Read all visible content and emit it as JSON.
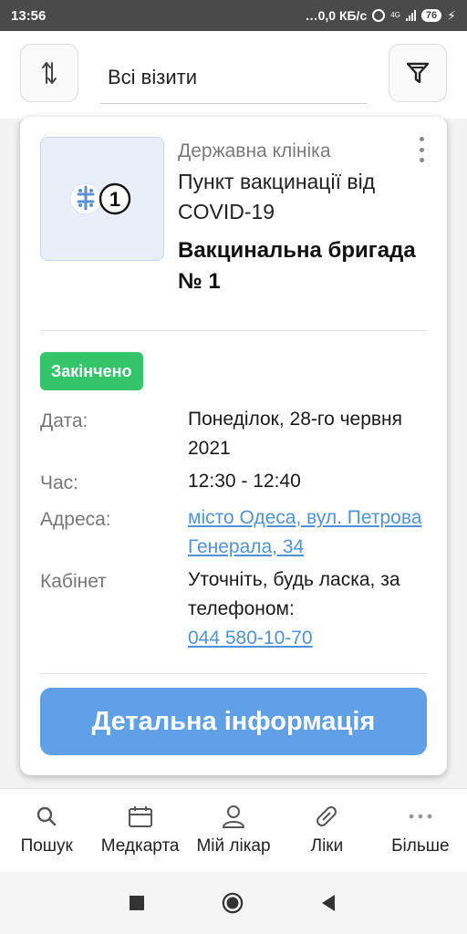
{
  "status_bar": {
    "time": "13:56",
    "speed": "…0,0 КБ/с",
    "network": "4G",
    "battery": "76"
  },
  "header": {
    "filter_select": "Всі візити"
  },
  "visit_card": {
    "clinic_type": "Державна клініка",
    "clinic_name": "Пункт вакцинації від COVID-19",
    "doctor_name": "Вакцинальна бригада № 1",
    "status": "Закінчено",
    "date_label": "Дата:",
    "date_value": "Понеділок, 28-го червня 2021",
    "time_label": "Час:",
    "time_value": "12:30 - 12:40",
    "address_label": "Адреса:",
    "address_value": "місто Одеса, вул. Петрова Генерала, 34",
    "room_label": "Кабінет",
    "room_value": "Уточніть, будь ласка, за телефоном:",
    "phone": "044 580-10-70",
    "details_button": "Детальна інформація",
    "thumb_number": "1"
  },
  "bottom_nav": {
    "items": [
      {
        "label": "Пошук",
        "icon": "search-icon"
      },
      {
        "label": "Медкарта",
        "icon": "calendar-icon"
      },
      {
        "label": "Мій лікар",
        "icon": "doctor-icon"
      },
      {
        "label": "Ліки",
        "icon": "pill-icon"
      },
      {
        "label": "Більше",
        "icon": "more-icon"
      }
    ]
  },
  "colors": {
    "status_badge": "#34c56a",
    "primary_button": "#5fa0e6",
    "link": "#4e93d8"
  }
}
